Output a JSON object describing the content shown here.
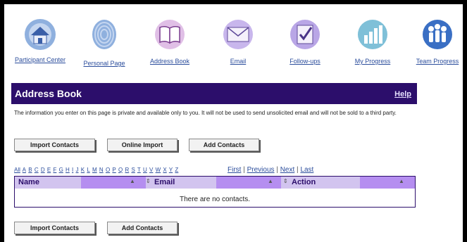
{
  "nav": [
    {
      "label": "Participant Center",
      "icon": "house-icon"
    },
    {
      "label": "Personal Page",
      "icon": "fingerprint-icon"
    },
    {
      "label": "Address Book",
      "icon": "book-icon"
    },
    {
      "label": "Email",
      "icon": "envelope-icon"
    },
    {
      "label": "Follow-ups",
      "icon": "checklist-icon"
    },
    {
      "label": "My Progress",
      "icon": "bar-chart-icon"
    },
    {
      "label": "Team Progress",
      "icon": "team-icon"
    }
  ],
  "header": {
    "title": "Address Book",
    "help": "Help"
  },
  "privacy_text": "The information you enter on this page is private and available only to you. It will not be used to send unsolicited email and will not be sold to a third party.",
  "buttons_top": [
    "Import Contacts",
    "Online Import",
    "Add Contacts"
  ],
  "alphabet": [
    "All",
    "A",
    "B",
    "C",
    "D",
    "E",
    "F",
    "G",
    "H",
    "I",
    "J",
    "K",
    "L",
    "M",
    "N",
    "O",
    "P",
    "Q",
    "R",
    "S",
    "T",
    "U",
    "V",
    "W",
    "X",
    "Y",
    "Z"
  ],
  "paging": {
    "first": "First",
    "previous": "Previous",
    "next": "Next",
    "last": "Last"
  },
  "table": {
    "columns": [
      "Name",
      "Email",
      "Action"
    ],
    "empty_message": "There are no contacts."
  },
  "buttons_bottom": [
    "Import Contacts",
    "Add Contacts"
  ],
  "colors": {
    "header_bg": "#2c0e6b",
    "table_header": "#d2c4ef",
    "link": "#2b4d9c"
  }
}
